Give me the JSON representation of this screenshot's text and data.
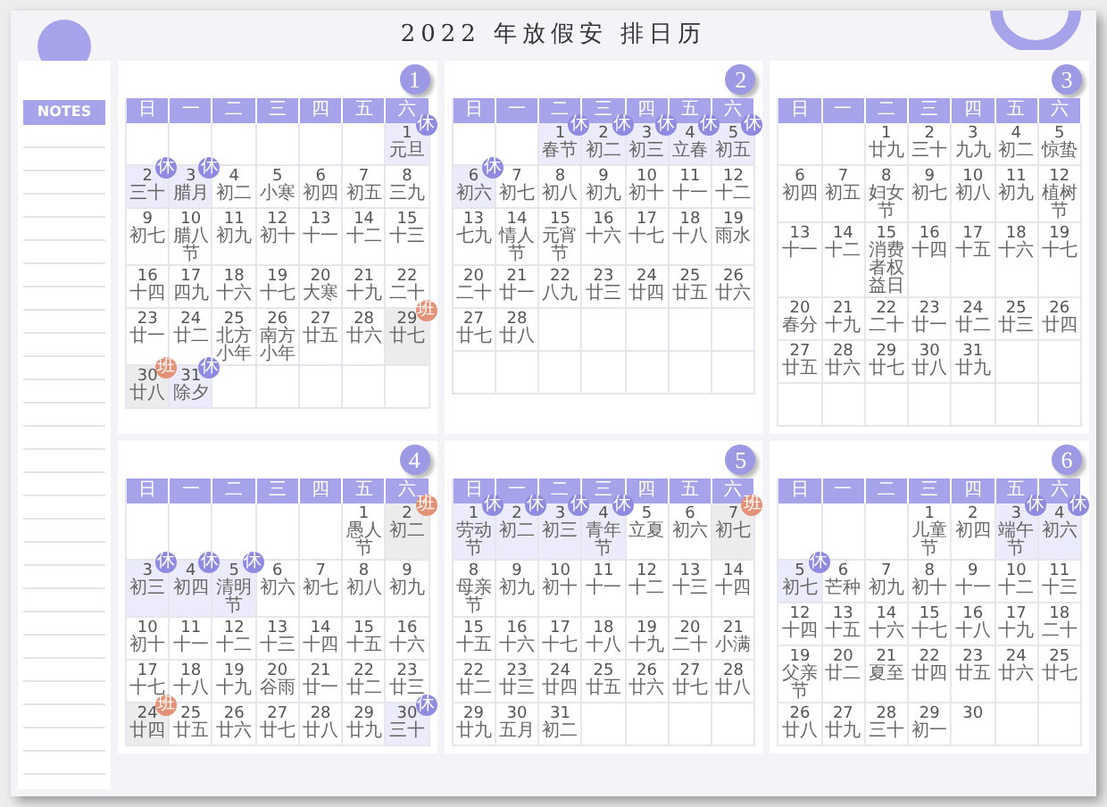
{
  "title": "2022 年放假安 排日历",
  "notes": {
    "title": "NOTES"
  },
  "months": [
    {
      "number": "1",
      "weekdays": [
        "日",
        "一",
        "二",
        "三",
        "四",
        "五",
        "六"
      ],
      "weeks": [
        [
          {
            "kind": "blank"
          },
          {
            "kind": "blank"
          },
          {
            "kind": "blank"
          },
          {
            "kind": "blank"
          },
          {
            "kind": "blank"
          },
          {
            "kind": "blank"
          },
          {
            "day": "1",
            "lunar": "元旦",
            "kind": "rest",
            "badge": "休"
          }
        ],
        [
          {
            "day": "2",
            "lunar": "三十",
            "kind": "rest",
            "badge": "休"
          },
          {
            "day": "3",
            "lunar": "腊月",
            "kind": "rest",
            "badge": "休"
          },
          {
            "day": "4",
            "lunar": "初二",
            "kind": "normal"
          },
          {
            "day": "5",
            "lunar": "小寒",
            "kind": "normal"
          },
          {
            "day": "6",
            "lunar": "初四",
            "kind": "normal"
          },
          {
            "day": "7",
            "lunar": "初五",
            "kind": "normal"
          },
          {
            "day": "8",
            "lunar": "三九",
            "kind": "normal"
          }
        ],
        [
          {
            "day": "9",
            "lunar": "初七",
            "kind": "normal"
          },
          {
            "day": "10",
            "lunar": "腊八节",
            "kind": "normal"
          },
          {
            "day": "11",
            "lunar": "初九",
            "kind": "normal"
          },
          {
            "day": "12",
            "lunar": "初十",
            "kind": "normal"
          },
          {
            "day": "13",
            "lunar": "十一",
            "kind": "normal"
          },
          {
            "day": "14",
            "lunar": "十二",
            "kind": "normal"
          },
          {
            "day": "15",
            "lunar": "十三",
            "kind": "normal"
          }
        ],
        [
          {
            "day": "16",
            "lunar": "十四",
            "kind": "normal"
          },
          {
            "day": "17",
            "lunar": "四九",
            "kind": "normal"
          },
          {
            "day": "18",
            "lunar": "十六",
            "kind": "normal"
          },
          {
            "day": "19",
            "lunar": "十七",
            "kind": "normal"
          },
          {
            "day": "20",
            "lunar": "大寒",
            "kind": "normal"
          },
          {
            "day": "21",
            "lunar": "十九",
            "kind": "normal"
          },
          {
            "day": "22",
            "lunar": "二十",
            "kind": "normal"
          }
        ],
        [
          {
            "day": "23",
            "lunar": "廿一",
            "kind": "normal"
          },
          {
            "day": "24",
            "lunar": "廿二",
            "kind": "normal"
          },
          {
            "day": "25",
            "lunar": "北方小年",
            "kind": "normal"
          },
          {
            "day": "26",
            "lunar": "南方小年",
            "kind": "normal"
          },
          {
            "day": "27",
            "lunar": "廿五",
            "kind": "normal"
          },
          {
            "day": "28",
            "lunar": "廿六",
            "kind": "normal"
          },
          {
            "day": "29",
            "lunar": "廿七",
            "kind": "work",
            "badge": "班"
          }
        ],
        [
          {
            "day": "30",
            "lunar": "廿八",
            "kind": "work",
            "badge": "班"
          },
          {
            "day": "31",
            "lunar": "除夕",
            "kind": "rest",
            "badge": "休"
          },
          {
            "kind": "blank"
          },
          {
            "kind": "blank"
          },
          {
            "kind": "blank"
          },
          {
            "kind": "blank"
          },
          {
            "kind": "blank"
          }
        ]
      ]
    },
    {
      "number": "2",
      "weekdays": [
        "日",
        "一",
        "二",
        "三",
        "四",
        "五",
        "六"
      ],
      "weeks": [
        [
          {
            "kind": "blank"
          },
          {
            "kind": "blank"
          },
          {
            "day": "1",
            "lunar": "春节",
            "kind": "rest",
            "badge": "休"
          },
          {
            "day": "2",
            "lunar": "初二",
            "kind": "rest",
            "badge": "休"
          },
          {
            "day": "3",
            "lunar": "初三",
            "kind": "rest",
            "badge": "休"
          },
          {
            "day": "4",
            "lunar": "立春",
            "kind": "rest",
            "badge": "休"
          },
          {
            "day": "5",
            "lunar": "初五",
            "kind": "rest",
            "badge": "休"
          }
        ],
        [
          {
            "day": "6",
            "lunar": "初六",
            "kind": "rest",
            "badge": "休"
          },
          {
            "day": "7",
            "lunar": "初七",
            "kind": "normal"
          },
          {
            "day": "8",
            "lunar": "初八",
            "kind": "normal"
          },
          {
            "day": "9",
            "lunar": "初九",
            "kind": "normal"
          },
          {
            "day": "10",
            "lunar": "初十",
            "kind": "normal"
          },
          {
            "day": "11",
            "lunar": "十一",
            "kind": "normal"
          },
          {
            "day": "12",
            "lunar": "十二",
            "kind": "normal"
          }
        ],
        [
          {
            "day": "13",
            "lunar": "七九",
            "kind": "normal"
          },
          {
            "day": "14",
            "lunar": "情人节",
            "kind": "normal"
          },
          {
            "day": "15",
            "lunar": "元宵节",
            "kind": "normal"
          },
          {
            "day": "16",
            "lunar": "十六",
            "kind": "normal"
          },
          {
            "day": "17",
            "lunar": "十七",
            "kind": "normal"
          },
          {
            "day": "18",
            "lunar": "十八",
            "kind": "normal"
          },
          {
            "day": "19",
            "lunar": "雨水",
            "kind": "normal"
          }
        ],
        [
          {
            "day": "20",
            "lunar": "二十",
            "kind": "normal"
          },
          {
            "day": "21",
            "lunar": "廿一",
            "kind": "normal"
          },
          {
            "day": "22",
            "lunar": "八九",
            "kind": "normal"
          },
          {
            "day": "23",
            "lunar": "廿三",
            "kind": "normal"
          },
          {
            "day": "24",
            "lunar": "廿四",
            "kind": "normal"
          },
          {
            "day": "25",
            "lunar": "廿五",
            "kind": "normal"
          },
          {
            "day": "26",
            "lunar": "廿六",
            "kind": "normal"
          }
        ],
        [
          {
            "day": "27",
            "lunar": "廿七",
            "kind": "normal"
          },
          {
            "day": "28",
            "lunar": "廿八",
            "kind": "normal"
          },
          {
            "kind": "blank"
          },
          {
            "kind": "blank"
          },
          {
            "kind": "blank"
          },
          {
            "kind": "blank"
          },
          {
            "kind": "blank"
          }
        ],
        [
          {
            "kind": "blank"
          },
          {
            "kind": "blank"
          },
          {
            "kind": "blank"
          },
          {
            "kind": "blank"
          },
          {
            "kind": "blank"
          },
          {
            "kind": "blank"
          },
          {
            "kind": "blank"
          }
        ]
      ]
    },
    {
      "number": "3",
      "weekdays": [
        "日",
        "一",
        "二",
        "三",
        "四",
        "五",
        "六"
      ],
      "weeks": [
        [
          {
            "kind": "blank"
          },
          {
            "kind": "blank"
          },
          {
            "day": "1",
            "lunar": "廿九",
            "kind": "normal"
          },
          {
            "day": "2",
            "lunar": "三十",
            "kind": "normal"
          },
          {
            "day": "3",
            "lunar": "九九",
            "kind": "normal"
          },
          {
            "day": "4",
            "lunar": "初二",
            "kind": "normal"
          },
          {
            "day": "5",
            "lunar": "惊蛰",
            "kind": "normal"
          }
        ],
        [
          {
            "day": "6",
            "lunar": "初四",
            "kind": "normal"
          },
          {
            "day": "7",
            "lunar": "初五",
            "kind": "normal"
          },
          {
            "day": "8",
            "lunar": "妇女节",
            "kind": "normal"
          },
          {
            "day": "9",
            "lunar": "初七",
            "kind": "normal"
          },
          {
            "day": "10",
            "lunar": "初八",
            "kind": "normal"
          },
          {
            "day": "11",
            "lunar": "初九",
            "kind": "normal"
          },
          {
            "day": "12",
            "lunar": "植树节",
            "kind": "normal"
          }
        ],
        [
          {
            "day": "13",
            "lunar": "十一",
            "kind": "normal"
          },
          {
            "day": "14",
            "lunar": "十二",
            "kind": "normal"
          },
          {
            "day": "15",
            "lunar": "消费者权益日",
            "kind": "normal"
          },
          {
            "day": "16",
            "lunar": "十四",
            "kind": "normal"
          },
          {
            "day": "17",
            "lunar": "十五",
            "kind": "normal"
          },
          {
            "day": "18",
            "lunar": "十六",
            "kind": "normal"
          },
          {
            "day": "19",
            "lunar": "十七",
            "kind": "normal"
          }
        ],
        [
          {
            "day": "20",
            "lunar": "春分",
            "kind": "normal"
          },
          {
            "day": "21",
            "lunar": "十九",
            "kind": "normal"
          },
          {
            "day": "22",
            "lunar": "二十",
            "kind": "normal"
          },
          {
            "day": "23",
            "lunar": "廿一",
            "kind": "normal"
          },
          {
            "day": "24",
            "lunar": "廿二",
            "kind": "normal"
          },
          {
            "day": "25",
            "lunar": "廿三",
            "kind": "normal"
          },
          {
            "day": "26",
            "lunar": "廿四",
            "kind": "normal"
          }
        ],
        [
          {
            "day": "27",
            "lunar": "廿五",
            "kind": "normal"
          },
          {
            "day": "28",
            "lunar": "廿六",
            "kind": "normal"
          },
          {
            "day": "29",
            "lunar": "廿七",
            "kind": "normal"
          },
          {
            "day": "30",
            "lunar": "廿八",
            "kind": "normal"
          },
          {
            "day": "31",
            "lunar": "廿九",
            "kind": "normal"
          },
          {
            "kind": "blank"
          },
          {
            "kind": "blank"
          }
        ],
        [
          {
            "kind": "blank"
          },
          {
            "kind": "blank"
          },
          {
            "kind": "blank"
          },
          {
            "kind": "blank"
          },
          {
            "kind": "blank"
          },
          {
            "kind": "blank"
          },
          {
            "kind": "blank"
          }
        ]
      ]
    },
    {
      "number": "4",
      "weekdays": [
        "日",
        "一",
        "二",
        "三",
        "四",
        "五",
        "六"
      ],
      "weeks": [
        [
          {
            "kind": "blank"
          },
          {
            "kind": "blank"
          },
          {
            "kind": "blank"
          },
          {
            "kind": "blank"
          },
          {
            "kind": "blank"
          },
          {
            "day": "1",
            "lunar": "愚人节",
            "kind": "normal"
          },
          {
            "day": "2",
            "lunar": "初二",
            "kind": "work",
            "badge": "班"
          }
        ],
        [
          {
            "day": "3",
            "lunar": "初三",
            "kind": "rest",
            "badge": "休"
          },
          {
            "day": "4",
            "lunar": "初四",
            "kind": "rest",
            "badge": "休"
          },
          {
            "day": "5",
            "lunar": "清明节",
            "kind": "rest",
            "badge": "休"
          },
          {
            "day": "6",
            "lunar": "初六",
            "kind": "normal"
          },
          {
            "day": "7",
            "lunar": "初七",
            "kind": "normal"
          },
          {
            "day": "8",
            "lunar": "初八",
            "kind": "normal"
          },
          {
            "day": "9",
            "lunar": "初九",
            "kind": "normal"
          }
        ],
        [
          {
            "day": "10",
            "lunar": "初十",
            "kind": "normal"
          },
          {
            "day": "11",
            "lunar": "十一",
            "kind": "normal"
          },
          {
            "day": "12",
            "lunar": "十二",
            "kind": "normal"
          },
          {
            "day": "13",
            "lunar": "十三",
            "kind": "normal"
          },
          {
            "day": "14",
            "lunar": "十四",
            "kind": "normal"
          },
          {
            "day": "15",
            "lunar": "十五",
            "kind": "normal"
          },
          {
            "day": "16",
            "lunar": "十六",
            "kind": "normal"
          }
        ],
        [
          {
            "day": "17",
            "lunar": "十七",
            "kind": "normal"
          },
          {
            "day": "18",
            "lunar": "十八",
            "kind": "normal"
          },
          {
            "day": "19",
            "lunar": "十九",
            "kind": "normal"
          },
          {
            "day": "20",
            "lunar": "谷雨",
            "kind": "normal"
          },
          {
            "day": "21",
            "lunar": "廿一",
            "kind": "normal"
          },
          {
            "day": "22",
            "lunar": "廿二",
            "kind": "normal"
          },
          {
            "day": "23",
            "lunar": "廿三",
            "kind": "normal"
          }
        ],
        [
          {
            "day": "24",
            "lunar": "廿四",
            "kind": "work",
            "badge": "班"
          },
          {
            "day": "25",
            "lunar": "廿五",
            "kind": "normal"
          },
          {
            "day": "26",
            "lunar": "廿六",
            "kind": "normal"
          },
          {
            "day": "27",
            "lunar": "廿七",
            "kind": "normal"
          },
          {
            "day": "28",
            "lunar": "廿八",
            "kind": "normal"
          },
          {
            "day": "29",
            "lunar": "廿九",
            "kind": "normal"
          },
          {
            "day": "30",
            "lunar": "三十",
            "kind": "rest",
            "badge": "休"
          }
        ]
      ]
    },
    {
      "number": "5",
      "weekdays": [
        "日",
        "一",
        "二",
        "三",
        "四",
        "五",
        "六"
      ],
      "weeks": [
        [
          {
            "day": "1",
            "lunar": "劳动节",
            "kind": "rest",
            "badge": "休"
          },
          {
            "day": "2",
            "lunar": "初二",
            "kind": "rest",
            "badge": "休"
          },
          {
            "day": "3",
            "lunar": "初三",
            "kind": "rest",
            "badge": "休"
          },
          {
            "day": "4",
            "lunar": "青年节",
            "kind": "rest",
            "badge": "休"
          },
          {
            "day": "5",
            "lunar": "立夏",
            "kind": "normal"
          },
          {
            "day": "6",
            "lunar": "初六",
            "kind": "normal"
          },
          {
            "day": "7",
            "lunar": "初七",
            "kind": "work",
            "badge": "班"
          }
        ],
        [
          {
            "day": "8",
            "lunar": "母亲节",
            "kind": "normal"
          },
          {
            "day": "9",
            "lunar": "初九",
            "kind": "normal"
          },
          {
            "day": "10",
            "lunar": "初十",
            "kind": "normal"
          },
          {
            "day": "11",
            "lunar": "十一",
            "kind": "normal"
          },
          {
            "day": "12",
            "lunar": "十二",
            "kind": "normal"
          },
          {
            "day": "13",
            "lunar": "十三",
            "kind": "normal"
          },
          {
            "day": "14",
            "lunar": "十四",
            "kind": "normal"
          }
        ],
        [
          {
            "day": "15",
            "lunar": "十五",
            "kind": "normal"
          },
          {
            "day": "16",
            "lunar": "十六",
            "kind": "normal"
          },
          {
            "day": "17",
            "lunar": "十七",
            "kind": "normal"
          },
          {
            "day": "18",
            "lunar": "十八",
            "kind": "normal"
          },
          {
            "day": "19",
            "lunar": "十九",
            "kind": "normal"
          },
          {
            "day": "20",
            "lunar": "二十",
            "kind": "normal"
          },
          {
            "day": "21",
            "lunar": "小满",
            "kind": "normal"
          }
        ],
        [
          {
            "day": "22",
            "lunar": "廿二",
            "kind": "normal"
          },
          {
            "day": "23",
            "lunar": "廿三",
            "kind": "normal"
          },
          {
            "day": "24",
            "lunar": "廿四",
            "kind": "normal"
          },
          {
            "day": "25",
            "lunar": "廿五",
            "kind": "normal"
          },
          {
            "day": "26",
            "lunar": "廿六",
            "kind": "normal"
          },
          {
            "day": "27",
            "lunar": "廿七",
            "kind": "normal"
          },
          {
            "day": "28",
            "lunar": "廿八",
            "kind": "normal"
          }
        ],
        [
          {
            "day": "29",
            "lunar": "廿九",
            "kind": "normal"
          },
          {
            "day": "30",
            "lunar": "五月",
            "kind": "normal"
          },
          {
            "day": "31",
            "lunar": "初二",
            "kind": "normal"
          },
          {
            "kind": "blank"
          },
          {
            "kind": "blank"
          },
          {
            "kind": "blank"
          },
          {
            "kind": "blank"
          }
        ]
      ]
    },
    {
      "number": "6",
      "weekdays": [
        "日",
        "一",
        "二",
        "三",
        "四",
        "五",
        "六"
      ],
      "weeks": [
        [
          {
            "kind": "blank"
          },
          {
            "kind": "blank"
          },
          {
            "kind": "blank"
          },
          {
            "day": "1",
            "lunar": "儿童节",
            "kind": "normal"
          },
          {
            "day": "2",
            "lunar": "初四",
            "kind": "normal"
          },
          {
            "day": "3",
            "lunar": "端午节",
            "kind": "rest",
            "badge": "休"
          },
          {
            "day": "4",
            "lunar": "初六",
            "kind": "rest",
            "badge": "休"
          }
        ],
        [
          {
            "day": "5",
            "lunar": "初七",
            "kind": "rest",
            "badge": "休"
          },
          {
            "day": "6",
            "lunar": "芒种",
            "kind": "normal"
          },
          {
            "day": "7",
            "lunar": "初九",
            "kind": "normal"
          },
          {
            "day": "8",
            "lunar": "初十",
            "kind": "normal"
          },
          {
            "day": "9",
            "lunar": "十一",
            "kind": "normal"
          },
          {
            "day": "10",
            "lunar": "十二",
            "kind": "normal"
          },
          {
            "day": "11",
            "lunar": "十三",
            "kind": "normal"
          }
        ],
        [
          {
            "day": "12",
            "lunar": "十四",
            "kind": "normal"
          },
          {
            "day": "13",
            "lunar": "十五",
            "kind": "normal"
          },
          {
            "day": "14",
            "lunar": "十六",
            "kind": "normal"
          },
          {
            "day": "15",
            "lunar": "十七",
            "kind": "normal"
          },
          {
            "day": "16",
            "lunar": "十八",
            "kind": "normal"
          },
          {
            "day": "17",
            "lunar": "十九",
            "kind": "normal"
          },
          {
            "day": "18",
            "lunar": "二十",
            "kind": "normal"
          }
        ],
        [
          {
            "day": "19",
            "lunar": "父亲节",
            "kind": "normal"
          },
          {
            "day": "20",
            "lunar": "廿二",
            "kind": "normal"
          },
          {
            "day": "21",
            "lunar": "夏至",
            "kind": "normal"
          },
          {
            "day": "22",
            "lunar": "廿四",
            "kind": "normal"
          },
          {
            "day": "23",
            "lunar": "廿五",
            "kind": "normal"
          },
          {
            "day": "24",
            "lunar": "廿六",
            "kind": "normal"
          },
          {
            "day": "25",
            "lunar": "廿七",
            "kind": "normal"
          }
        ],
        [
          {
            "day": "26",
            "lunar": "廿八",
            "kind": "normal"
          },
          {
            "day": "27",
            "lunar": "廿九",
            "kind": "normal"
          },
          {
            "day": "28",
            "lunar": "三十",
            "kind": "normal"
          },
          {
            "day": "29",
            "lunar": "初一",
            "kind": "normal"
          },
          {
            "day": "30",
            "kind": "normal"
          },
          {
            "kind": "blank"
          },
          {
            "kind": "blank"
          }
        ]
      ]
    }
  ]
}
